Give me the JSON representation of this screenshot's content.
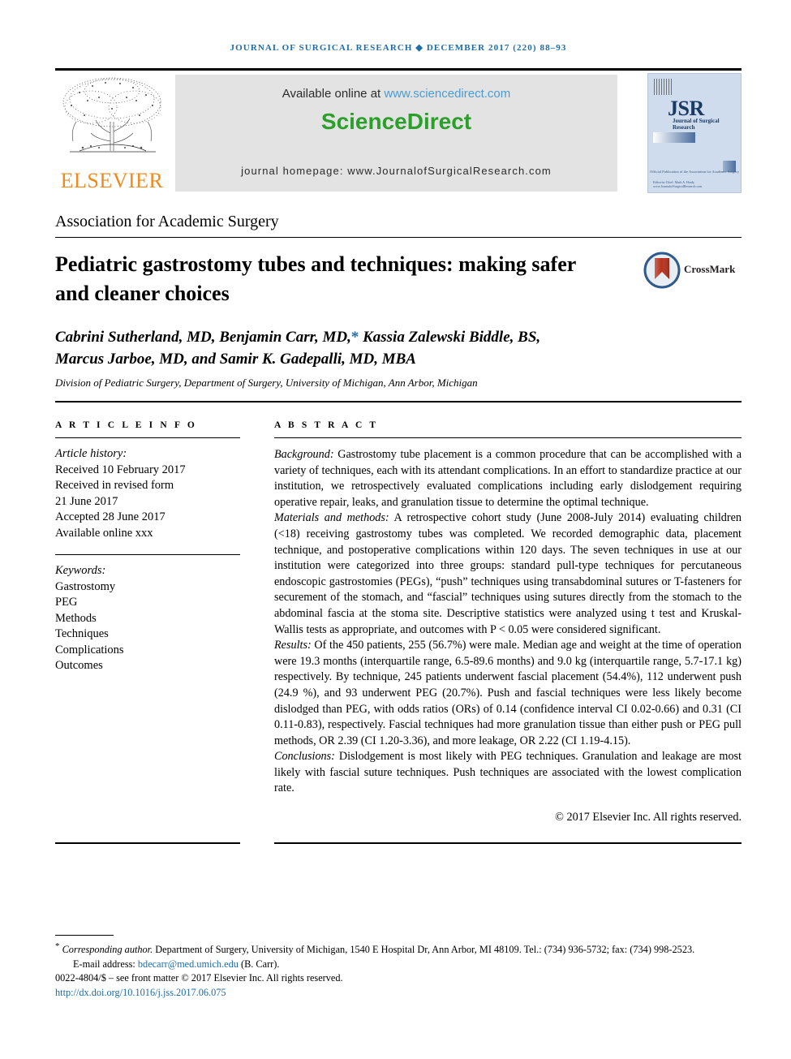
{
  "running_head": "JOURNAL OF SURGICAL RESEARCH ◆ DECEMBER 2017 (220) 88–93",
  "masthead": {
    "elsevier_wordmark": "ELSEVIER",
    "available_prefix": "Available online at ",
    "available_url": "www.sciencedirect.com",
    "sciencedirect_wordmark": "ScienceDirect",
    "journal_homepage": "journal homepage: www.JournalofSurgicalResearch.com",
    "cover": {
      "title": "JSR",
      "subtitle": "Journal of Surgical Research",
      "association": "Official Publication of the Association for Academic Surgery",
      "footer": "Editor-in-Chief: Mark A. Hardy\nwww.JournalofSurgicalResearch.com"
    }
  },
  "society_line": "Association for Academic Surgery",
  "title": "Pediatric gastrostomy tubes and techniques: making safer and cleaner choices",
  "crossmark_label": "CrossMark",
  "authors_line1_a": "Cabrini Sutherland, MD, Benjamin Carr, MD,",
  "authors_star": "*",
  "authors_line1_b": " Kassia Zalewski Biddle, BS,",
  "authors_line2": "Marcus Jarboe, MD, and Samir K. Gadepalli, MD, MBA",
  "affiliation": "Division of Pediatric Surgery, Department of Surgery, University of Michigan, Ann Arbor, Michigan",
  "article_info": {
    "heading": "A R T I C L E  I N F O",
    "history_label": "Article history:",
    "history": [
      "Received 10 February 2017",
      "Received in revised form",
      "21 June 2017",
      "Accepted 28 June 2017",
      "Available online xxx"
    ],
    "keywords_label": "Keywords:",
    "keywords": [
      "Gastrostomy",
      "PEG",
      "Methods",
      "Techniques",
      "Complications",
      "Outcomes"
    ]
  },
  "abstract": {
    "heading": "A B S T R A C T",
    "background_label": "Background:",
    "background_text": " Gastrostomy tube placement is a common procedure that can be accomplished with a variety of techniques, each with its attendant complications. In an effort to standardize practice at our institution, we retrospectively evaluated complications including early dislodgement requiring operative repair, leaks, and granulation tissue to determine the optimal technique.",
    "methods_label": "Materials and methods:",
    "methods_text": " A retrospective cohort study (June 2008-July 2014) evaluating children (<18) receiving gastrostomy tubes was completed. We recorded demographic data, placement technique, and postoperative complications within 120 days. The seven techniques in use at our institution were categorized into three groups: standard pull-type techniques for percutaneous endoscopic gastrostomies (PEGs), “push” techniques using transabdominal sutures or T-fasteners for securement of the stomach, and “fascial” techniques using sutures directly from the stomach to the abdominal fascia at the stoma site. Descriptive statistics were analyzed using t test and Kruskal-Wallis tests as appropriate, and outcomes with P < 0.05 were considered significant.",
    "results_label": "Results:",
    "results_text": " Of the 450 patients, 255 (56.7%) were male. Median age and weight at the time of operation were 19.3 months (interquartile range, 6.5-89.6 months) and 9.0 kg (interquartile range, 5.7-17.1 kg) respectively. By technique, 245 patients underwent fascial placement (54.4%), 112 underwent push (24.9 %), and 93 underwent PEG (20.7%). Push and fascial techniques were less likely become dislodged than PEG, with odds ratios (ORs) of 0.14 (confidence interval CI 0.02-0.66) and 0.31 (CI 0.11-0.83), respectively. Fascial techniques had more granulation tissue than either push or PEG pull methods, OR 2.39 (CI 1.20-3.36), and more leakage, OR 2.22 (CI 1.19-4.15).",
    "conclusions_label": "Conclusions:",
    "conclusions_text": " Dislodgement is most likely with PEG techniques. Granulation and leakage are most likely with fascial suture techniques. Push techniques are associated with the lowest complication rate.",
    "copyright": "© 2017 Elsevier Inc. All rights reserved."
  },
  "footnotes": {
    "corresponding_label": "Corresponding author.",
    "corresponding_text": " Department of Surgery, University of Michigan, 1540 E Hospital Dr, Ann Arbor, MI 48109. Tel.: (734) 936-5732; fax: (734) 998-2523.",
    "email_label": "E-mail address: ",
    "email": "bdecarr@med.umich.edu",
    "email_suffix": " (B. Carr).",
    "issn_line": "0022-4804/$ – see front matter © 2017 Elsevier Inc. All rights reserved.",
    "doi": "http://dx.doi.org/10.1016/j.jss.2017.06.075"
  },
  "colors": {
    "link_blue": "#1e6ca8",
    "sciencedirect_green": "#2aa02a",
    "elsevier_orange": "#f08a1c",
    "banner_grey": "#e3e3e3"
  }
}
